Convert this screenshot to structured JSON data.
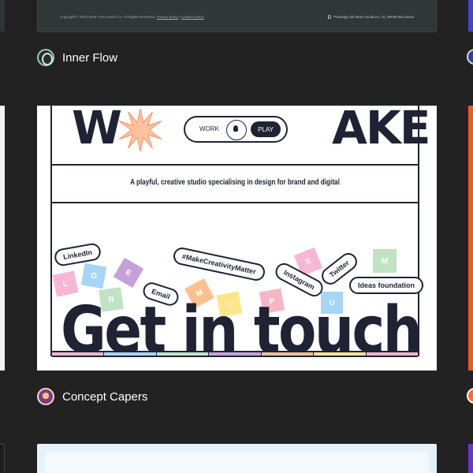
{
  "gallery": {
    "top_card": {
      "copyright": "Copyright © 2022 Inner Flow Studio Co. All Rights Reserved.",
      "privacy_link": "Privacy policy",
      "separator": "|",
      "cookies_link": "Cookies policy",
      "address": "Passatge del Marie Scadrum, 15, 08038 Barcelona"
    },
    "sites": [
      {
        "name": "Inner Flow",
        "avatar_icon": "inner-flow-logo-icon"
      },
      {
        "name": "Concept Capers",
        "avatar_icon": "concept-capers-logo-icon"
      }
    ],
    "preview": {
      "wordmark_left": "W",
      "wordmark_right": "AKE",
      "toggle_work": "WORK",
      "toggle_play": "PLAY",
      "tagline": "A playful, creative studio specialising in design for brand and digital",
      "stickers": {
        "linkedin": "LinkedIn",
        "hashtag": "#MakeCreativityMatter",
        "instagram": "Instagram",
        "twitter": "Twitter",
        "email": "Email",
        "ideas": "Ideas foundation"
      },
      "tiles": [
        {
          "letter": "L",
          "color": "#f7b6d4"
        },
        {
          "letter": "O",
          "color": "#a6d5f5"
        },
        {
          "letter": "R",
          "color": "#bfe3c3"
        },
        {
          "letter": "E",
          "color": "#c7a0d8"
        },
        {
          "letter": "M",
          "color": "#ffc18f"
        },
        {
          "letter": "I",
          "color": "#ffe48a"
        },
        {
          "letter": "P",
          "color": "#f7b6c6"
        },
        {
          "letter": "S",
          "color": "#f7b6d4"
        },
        {
          "letter": "U",
          "color": "#a6d5f5"
        },
        {
          "letter": "M",
          "color": "#bfe3c3"
        }
      ],
      "headline": "Get in touch",
      "strip_colors": [
        "#f7b6d4",
        "#a6d5f5",
        "#bfe3c3",
        "#c7a0d8",
        "#ffc18f",
        "#ffe48a",
        "#f7b6c6"
      ]
    }
  }
}
